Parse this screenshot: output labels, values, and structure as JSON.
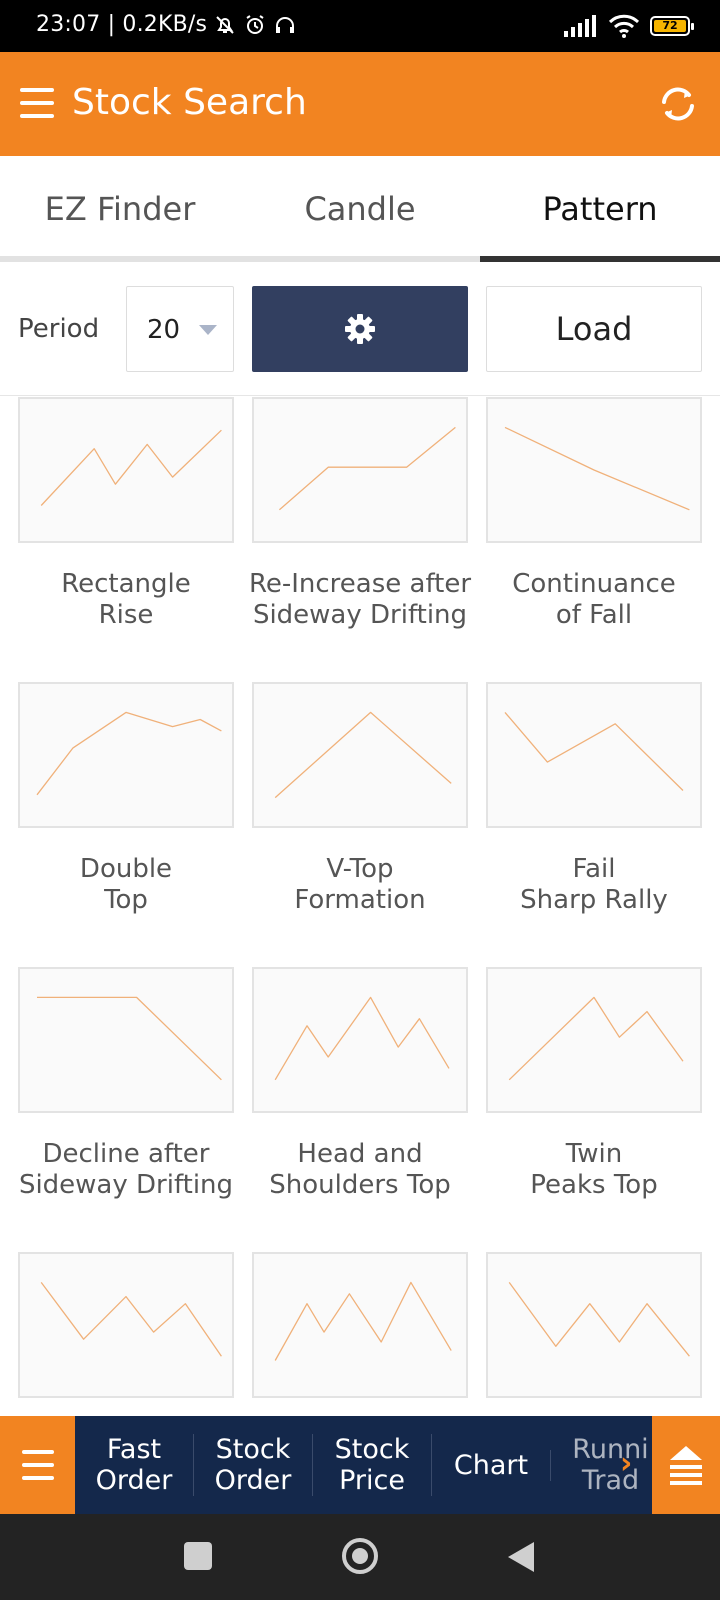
{
  "status_bar": {
    "time_speed": "23:07 | 0.2KB/s",
    "battery_level": "72",
    "icons": [
      "bell-off-icon",
      "alarm-icon",
      "headset-icon",
      "signal-icon",
      "wifi-icon",
      "battery-icon"
    ]
  },
  "app_bar": {
    "title": "Stock Search",
    "background": "#f28421",
    "icons": [
      "hamburger-menu-icon",
      "refresh-icon"
    ]
  },
  "tabs": [
    {
      "label": "EZ Finder",
      "active": false
    },
    {
      "label": "Candle",
      "active": false
    },
    {
      "label": "Pattern",
      "active": true
    }
  ],
  "controls": {
    "period_label": "Period",
    "period_value": "20",
    "settings_icon": "gear-icon",
    "load_label": "Load",
    "settings_color": "#323f60"
  },
  "patterns": [
    {
      "line1": "Rectangle",
      "line2": "Rise",
      "shape": [
        [
          0.1,
          0.75
        ],
        [
          0.35,
          0.35
        ],
        [
          0.45,
          0.6
        ],
        [
          0.6,
          0.32
        ],
        [
          0.72,
          0.55
        ],
        [
          0.95,
          0.22
        ]
      ]
    },
    {
      "line1": "Re-Increase after",
      "line2": "Sideway Drifting",
      "shape": [
        [
          0.12,
          0.78
        ],
        [
          0.35,
          0.48
        ],
        [
          0.72,
          0.48
        ],
        [
          0.95,
          0.2
        ]
      ]
    },
    {
      "line1": "Continuance",
      "line2": "of Fall",
      "shape": [
        [
          0.08,
          0.2
        ],
        [
          0.5,
          0.5
        ],
        [
          0.95,
          0.78
        ]
      ]
    },
    {
      "line1": "Double",
      "line2": "Top",
      "shape": [
        [
          0.08,
          0.78
        ],
        [
          0.25,
          0.45
        ],
        [
          0.5,
          0.2
        ],
        [
          0.72,
          0.3
        ],
        [
          0.85,
          0.25
        ],
        [
          0.95,
          0.33
        ]
      ]
    },
    {
      "line1": "V-Top",
      "line2": "Formation",
      "shape": [
        [
          0.1,
          0.8
        ],
        [
          0.55,
          0.2
        ],
        [
          0.93,
          0.7
        ]
      ]
    },
    {
      "line1": "Fail",
      "line2": "Sharp Rally",
      "shape": [
        [
          0.08,
          0.2
        ],
        [
          0.28,
          0.55
        ],
        [
          0.6,
          0.28
        ],
        [
          0.92,
          0.75
        ]
      ]
    },
    {
      "line1": "Decline after",
      "line2": "Sideway Drifting",
      "shape": [
        [
          0.08,
          0.2
        ],
        [
          0.55,
          0.2
        ],
        [
          0.95,
          0.78
        ]
      ]
    },
    {
      "line1": "Head and",
      "line2": "Shoulders Top",
      "shape": [
        [
          0.1,
          0.78
        ],
        [
          0.25,
          0.4
        ],
        [
          0.35,
          0.62
        ],
        [
          0.55,
          0.2
        ],
        [
          0.68,
          0.55
        ],
        [
          0.78,
          0.35
        ],
        [
          0.92,
          0.7
        ]
      ]
    },
    {
      "line1": "Twin",
      "line2": "Peaks Top",
      "shape": [
        [
          0.1,
          0.78
        ],
        [
          0.5,
          0.2
        ],
        [
          0.62,
          0.48
        ],
        [
          0.75,
          0.3
        ],
        [
          0.92,
          0.65
        ]
      ]
    },
    {
      "line1": "",
      "line2": "",
      "shape": [
        [
          0.1,
          0.2
        ],
        [
          0.3,
          0.6
        ],
        [
          0.5,
          0.3
        ],
        [
          0.63,
          0.55
        ],
        [
          0.78,
          0.35
        ],
        [
          0.95,
          0.72
        ]
      ]
    },
    {
      "line1": "",
      "line2": "",
      "shape": [
        [
          0.1,
          0.75
        ],
        [
          0.25,
          0.35
        ],
        [
          0.33,
          0.55
        ],
        [
          0.45,
          0.28
        ],
        [
          0.6,
          0.62
        ],
        [
          0.74,
          0.2
        ],
        [
          0.93,
          0.68
        ]
      ]
    },
    {
      "line1": "",
      "line2": "",
      "shape": [
        [
          0.1,
          0.2
        ],
        [
          0.32,
          0.65
        ],
        [
          0.48,
          0.35
        ],
        [
          0.62,
          0.62
        ],
        [
          0.75,
          0.35
        ],
        [
          0.95,
          0.72
        ]
      ]
    }
  ],
  "pattern_line_color": "#f0b17a",
  "bottom_bar": {
    "menu_icon": "hamburger-menu-icon",
    "items": [
      {
        "line1": "Fast",
        "line2": "Order"
      },
      {
        "line1": "Stock",
        "line2": "Order"
      },
      {
        "line1": "Stock",
        "line2": "Price"
      },
      {
        "line1": "Chart",
        "line2": ""
      },
      {
        "line1": "Runni",
        "line2": "Trad"
      }
    ],
    "arrow_icon": "chevron-right-icon",
    "right_icon": "eject-icon"
  },
  "nav_bar": {
    "icons": [
      "recents-square-icon",
      "home-circle-icon",
      "back-triangle-icon"
    ]
  }
}
